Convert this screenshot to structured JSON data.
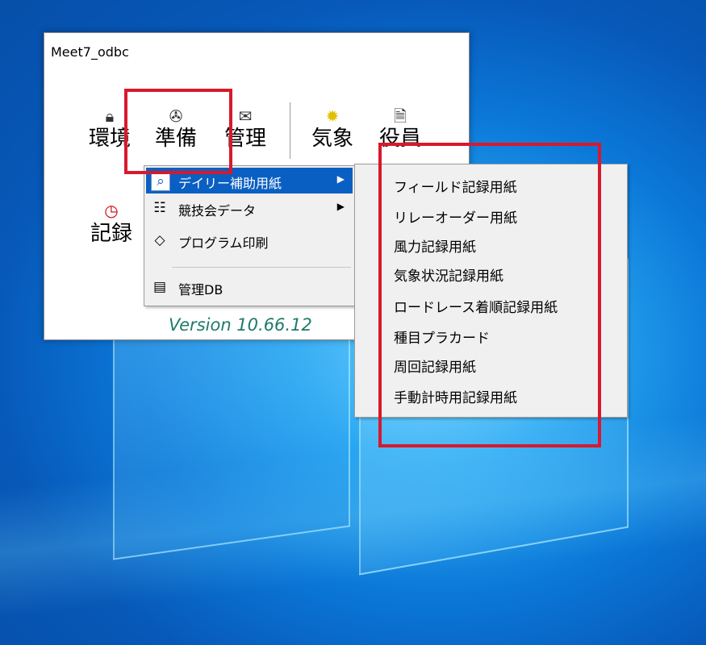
{
  "window": {
    "title": "Meet7_odbc",
    "toolbar": [
      {
        "label": "環境",
        "icon": "lock-icon"
      },
      {
        "label": "準備",
        "icon": "mouse-icon"
      },
      {
        "label": "管理",
        "icon": "envelope-icon"
      },
      {
        "label": "気象",
        "icon": "sun-icon"
      },
      {
        "label": "役員",
        "icon": "document-icon"
      }
    ],
    "record": {
      "label": "記録",
      "icon": "clock-icon"
    },
    "version": "Version 10.66.12"
  },
  "menu": {
    "items": [
      {
        "label": "デイリー補助用紙",
        "icon": "page-magnifier-icon",
        "has_submenu": true,
        "selected": true
      },
      {
        "label": "競技会データ",
        "icon": "tree-icon",
        "has_submenu": true
      },
      {
        "label": "プログラム印刷",
        "icon": "book-icon",
        "has_submenu": false
      },
      {
        "label": "管理DB",
        "icon": "database-icon",
        "has_submenu": false
      }
    ]
  },
  "submenu": {
    "items": [
      "フィールド記録用紙",
      "リレーオーダー用紙",
      "風力記録用紙",
      "気象状況記録用紙",
      "ロードレース着順記録用紙",
      "種目プラカード",
      "周回記録用紙",
      "手動計時用記録用紙"
    ]
  },
  "colors": {
    "highlight": "#d8192c",
    "menu_selection": "#0a5fc2",
    "version_text": "#1f7a6b"
  }
}
